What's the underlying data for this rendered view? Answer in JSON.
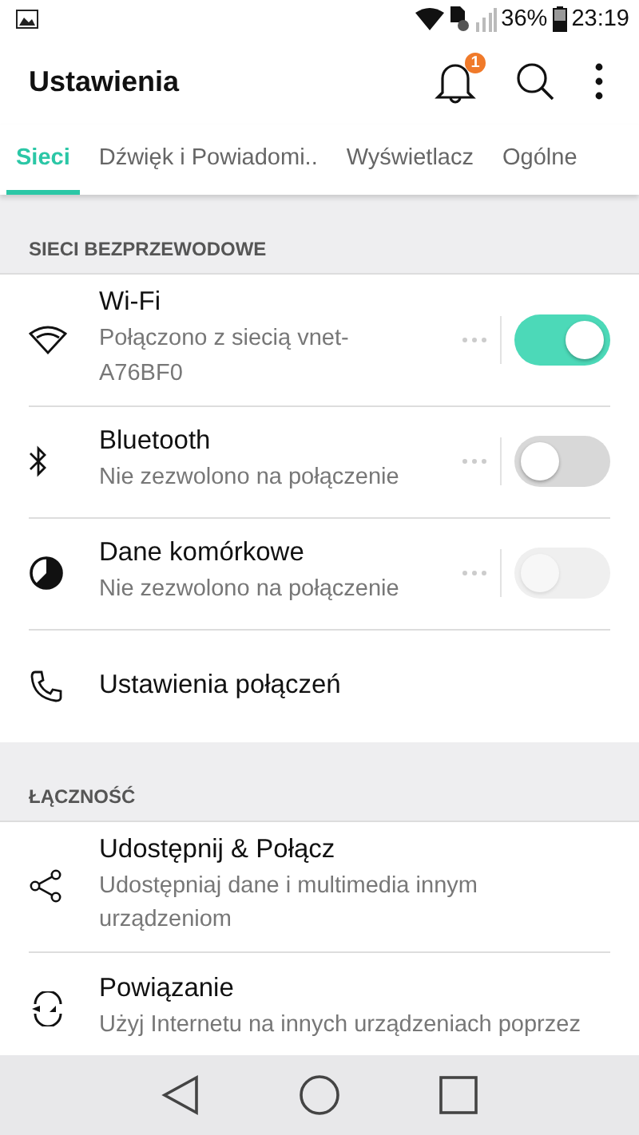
{
  "status_bar": {
    "battery": "36%",
    "time": "23:19"
  },
  "app_bar": {
    "title": "Ustawienia",
    "notification_count": "1"
  },
  "tabs": [
    {
      "label": "Sieci",
      "selected": true
    },
    {
      "label": "Dźwięk i Powiadomi..",
      "selected": false
    },
    {
      "label": "Wyświetlacz",
      "selected": false
    },
    {
      "label": "Ogólne",
      "selected": false
    }
  ],
  "sections": [
    {
      "header": "SIECI BEZPRZEWODOWE",
      "items": [
        {
          "kind": "toggle",
          "title": "Wi-Fi",
          "subtitle": "Połączono z siecią vnet-A76BF0",
          "on": true,
          "disabled": false
        },
        {
          "kind": "toggle",
          "title": "Bluetooth",
          "subtitle": "Nie zezwolono na połączenie",
          "on": false,
          "disabled": false
        },
        {
          "kind": "toggle",
          "title": "Dane komórkowe",
          "subtitle": "Nie zezwolono na połączenie",
          "on": false,
          "disabled": true
        },
        {
          "kind": "plain",
          "title": "Ustawienia połączeń"
        }
      ]
    },
    {
      "header": "ŁĄCZNOŚĆ",
      "items": [
        {
          "kind": "plain",
          "title": "Udostępnij & Połącz",
          "subtitle": "Udostępniaj dane i multimedia innym urządzeniom"
        },
        {
          "kind": "plain",
          "title": "Powiązanie",
          "subtitle": "Użyj Internetu na innych urządzeniach poprzez"
        }
      ]
    }
  ]
}
